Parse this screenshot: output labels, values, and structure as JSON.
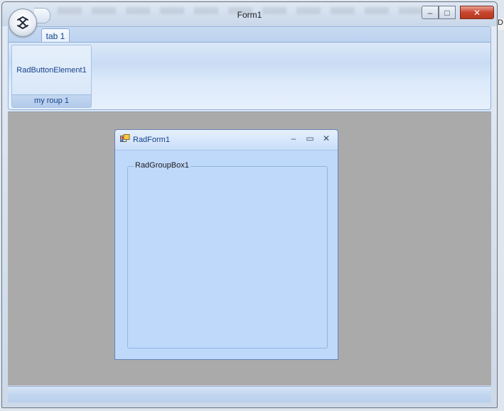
{
  "window": {
    "title": "Form1",
    "minimize_symbol": "–",
    "maximize_symbol": "□",
    "close_symbol": "✕",
    "right_cut_text": "D"
  },
  "ribbon": {
    "app_button_icon": "telerik-logo-icon",
    "tabs": [
      {
        "label": "tab 1"
      }
    ],
    "groups": [
      {
        "caption": "my roup 1",
        "button_label": "RadButtonElement1"
      }
    ]
  },
  "child_form": {
    "title": "RadForm1",
    "minimize_symbol": "–",
    "maximize_symbol": "▭",
    "close_symbol": "✕",
    "group_box_label": "RadGroupBox1"
  },
  "colors": {
    "client_background": "#abaaaa",
    "form_background": "#bfd9fb",
    "ribbon_text": "#15428b",
    "close_button": "#c8442e"
  }
}
